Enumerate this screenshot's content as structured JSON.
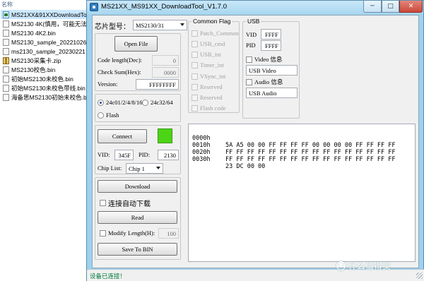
{
  "explorer": {
    "column_header": "名称",
    "files": [
      {
        "name": "MS21XX&91XXDownloadTo",
        "icon": "exe-icon",
        "selected": true
      },
      {
        "name": "MS2130 4K(慎用，可能无法使",
        "icon": "file-icon",
        "selected": false
      },
      {
        "name": "MS2130 4K2.bin",
        "icon": "file-icon",
        "selected": false
      },
      {
        "name": "MS2130_sample_20221026(2",
        "icon": "file-icon",
        "selected": false
      },
      {
        "name": "ms2130_sample_20230221 0",
        "icon": "file-icon",
        "selected": false
      },
      {
        "name": "MS2130采集卡.zip",
        "icon": "zip-icon",
        "selected": false
      },
      {
        "name": "MS2130校色.bin",
        "icon": "file-icon",
        "selected": false
      },
      {
        "name": "初始MS2130未校色.bin",
        "icon": "file-icon",
        "selected": false
      },
      {
        "name": "初始MS2130未校色带线.bin",
        "icon": "file-icon",
        "selected": false
      },
      {
        "name": "海备思MS2130初始未校色.bin",
        "icon": "file-icon",
        "selected": false
      }
    ]
  },
  "window": {
    "title": "MS21XX_MS91XX_DownloadTool_V1.7.0",
    "min_glyph": "─",
    "max_glyph": "□",
    "close_glyph": "✕"
  },
  "chip_model": {
    "label": "芯片型号：",
    "value": "MS2130/31"
  },
  "file_group": {
    "open_file": "Open File",
    "code_length_label": "Code length(Dec):",
    "code_length_value": "0",
    "check_sum_label": "Check Sum(Hex):",
    "check_sum_value": "0000",
    "version_label": "Version:",
    "version_value": "FFFFFFFF"
  },
  "flash_type": {
    "option1": "24c01/2/4/8/16",
    "option2": "24c32/64",
    "option3": "Flash",
    "selected": "24c01/2/4/8/16"
  },
  "connection": {
    "connect_label": "Connect",
    "status_color": "#4cd417",
    "vid_label": "VID:",
    "vid_value": "345F",
    "pid_label": "PID:",
    "pid_value": "2130",
    "chip_list_label": "Chip List:",
    "chip_list_value": "Chip 1"
  },
  "actions": {
    "download": "Download",
    "auto_download": "连接自动下载",
    "read": "Read",
    "modify": "Modify",
    "length_label": "Length(H):",
    "length_value": "100",
    "save_to_bin": "Save To BIN"
  },
  "common_flag": {
    "title": "Common Flag",
    "items": [
      "Patch_Common",
      "USB_cmd",
      "USB_int",
      "Timer_int",
      "VSync_int",
      "Reserved",
      "Reserved",
      "Flash code"
    ]
  },
  "usb": {
    "title": "USB",
    "vid_label": "VID",
    "vid_value": "FFFF",
    "pid_label": "PID",
    "pid_value": "FFFF",
    "video_info": "Video 信息",
    "video_name": "USB Video",
    "audio_info": "Audio 信息",
    "audio_name": "USB Audio"
  },
  "hex_dump": [
    {
      "addr": "0000h",
      "bytes": "5A A5 00 00 FF FF FF FF 00 00 00 00 FF FF FF FF"
    },
    {
      "addr": "0010h",
      "bytes": "FF FF FF FF FF FF FF FF FF FF FF FF FF FF FF FF"
    },
    {
      "addr": "0020h",
      "bytes": "FF FF FF FF FF FF FF FF FF FF FF FF FF FF FF FF"
    },
    {
      "addr": "0030h",
      "bytes": "23 DC 00 00"
    }
  ],
  "status_bar": {
    "text": "设备已连接！"
  },
  "watermark": {
    "text": "什么值得买"
  }
}
